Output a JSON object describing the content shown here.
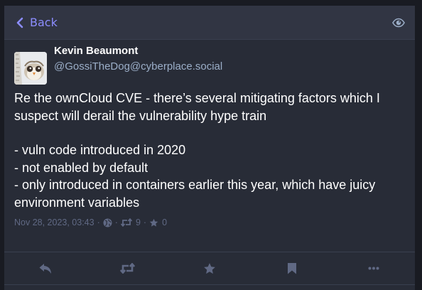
{
  "header": {
    "back_label": "Back",
    "back_icon": "chevron-left-icon",
    "visibility_toggle_icon": "eye-icon"
  },
  "status": {
    "display_name": "Kevin Beaumont",
    "account": "@GossiTheDog@cyberplace.social",
    "content": [
      "Re the ownCloud CVE - there’s several mitigating factors which I suspect will derail the vulnerability hype train",
      "- vuln code introduced in 2020\n- not enabled by default\n- only introduced in containers earlier this year, which have juicy environment variables"
    ],
    "timestamp": "Nov 28, 2023, 03:43",
    "separator": "·",
    "visibility_icon": "globe-icon",
    "boosts": "9",
    "favourites": "0"
  },
  "actions": [
    {
      "name": "reply-button",
      "icon": "reply-icon"
    },
    {
      "name": "boost-button",
      "icon": "retweet-icon"
    },
    {
      "name": "favourite-button",
      "icon": "star-icon"
    },
    {
      "name": "bookmark-button",
      "icon": "bookmark-icon"
    },
    {
      "name": "more-button",
      "icon": "ellipsis-icon"
    }
  ],
  "colors": {
    "background": "#191b22",
    "panel": "#282c37",
    "header": "#313543",
    "accent": "#8c8dff",
    "text": "#ffffff",
    "secondary_text": "#9baec8",
    "muted": "#606984"
  }
}
